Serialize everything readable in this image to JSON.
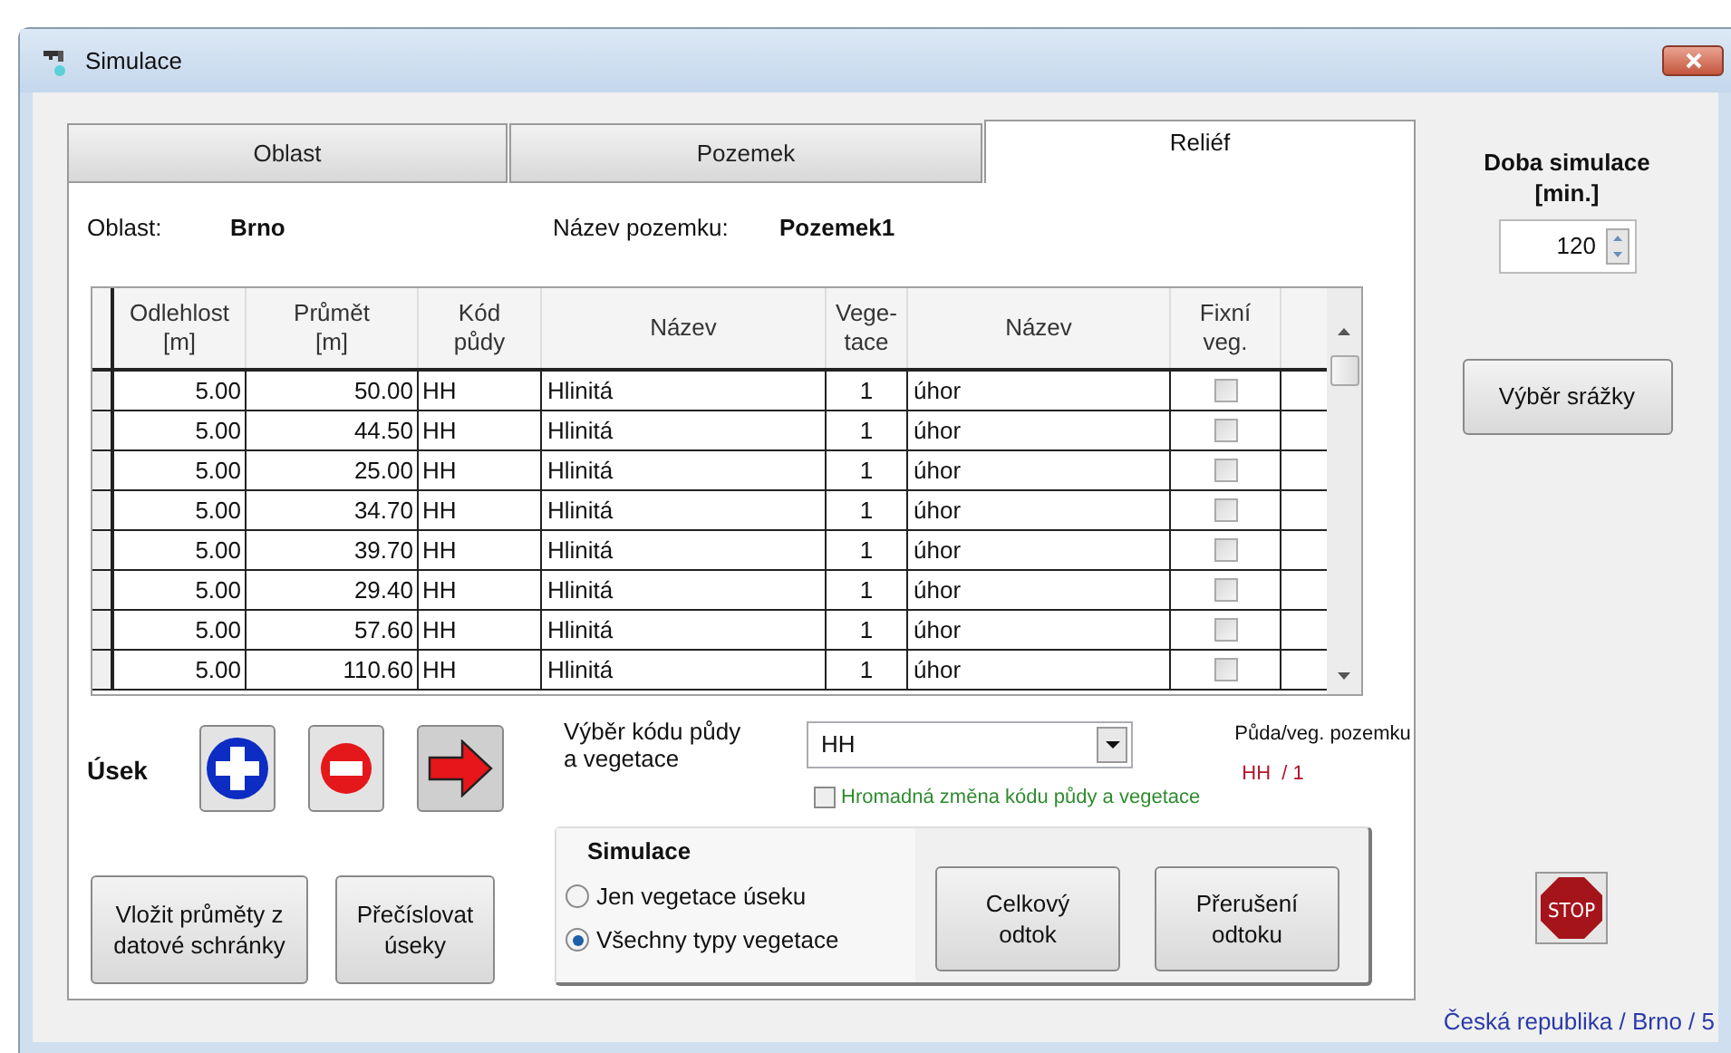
{
  "window": {
    "title": "Simulace"
  },
  "tabs": [
    {
      "label": "Oblast",
      "selected": false
    },
    {
      "label": "Pozemek",
      "selected": false
    },
    {
      "label": "Reliéf",
      "selected": true
    }
  ],
  "info": {
    "area_label": "Oblast:",
    "area_value": "Brno",
    "plot_label": "Název pozemku:",
    "plot_value": "Pozemek1"
  },
  "table": {
    "columns": [
      "Odlehlost\n[m]",
      "Průmět\n[m]",
      "Kód\npůdy",
      "Název",
      "Vege-\ntace",
      "Název",
      "Fixní\nveg."
    ],
    "rows": [
      {
        "cells": [
          "5.00",
          "50.00",
          "HH",
          "Hlinitá",
          "1",
          "úhor"
        ],
        "fixed_veg": false
      },
      {
        "cells": [
          "5.00",
          "44.50",
          "HH",
          "Hlinitá",
          "1",
          "úhor"
        ],
        "fixed_veg": false
      },
      {
        "cells": [
          "5.00",
          "25.00",
          "HH",
          "Hlinitá",
          "1",
          "úhor"
        ],
        "fixed_veg": false
      },
      {
        "cells": [
          "5.00",
          "34.70",
          "HH",
          "Hlinitá",
          "1",
          "úhor"
        ],
        "fixed_veg": false
      },
      {
        "cells": [
          "5.00",
          "39.70",
          "HH",
          "Hlinitá",
          "1",
          "úhor"
        ],
        "fixed_veg": false
      },
      {
        "cells": [
          "5.00",
          "29.40",
          "HH",
          "Hlinitá",
          "1",
          "úhor"
        ],
        "fixed_veg": false
      },
      {
        "cells": [
          "5.00",
          "57.60",
          "HH",
          "Hlinitá",
          "1",
          "úhor"
        ],
        "fixed_veg": false
      },
      {
        "cells": [
          "5.00",
          "110.60",
          "HH",
          "Hlinitá",
          "1",
          "úhor"
        ],
        "fixed_veg": false
      }
    ]
  },
  "segment": {
    "label": "Úsek"
  },
  "soil_select": {
    "label": "Výběr kódu půdy\na vegetace",
    "value": "HH"
  },
  "plot_code": {
    "label": "Půda/veg. pozemku",
    "value": "HH  / 1"
  },
  "bulk_change": {
    "label": "Hromadná změna kódu půdy a vegetace",
    "checked": false
  },
  "paste_button": "Vložit průměty z\ndatové schránky",
  "renumber_button": "Přečíslovat\núseky",
  "simulation": {
    "title": "Simulace",
    "options": [
      {
        "label": "Jen vegetace úseku",
        "selected": false
      },
      {
        "label": "Všechny typy vegetace",
        "selected": true
      }
    ],
    "buttons": [
      "Celkový\nodtok",
      "Přerušení\nodtoku"
    ]
  },
  "duration": {
    "label": "Doba simulace\n[min.]",
    "value": "120"
  },
  "rain_button": "Výběr srážky",
  "stop_sign": "STOP",
  "status": "Česká republika / Brno / 5"
}
